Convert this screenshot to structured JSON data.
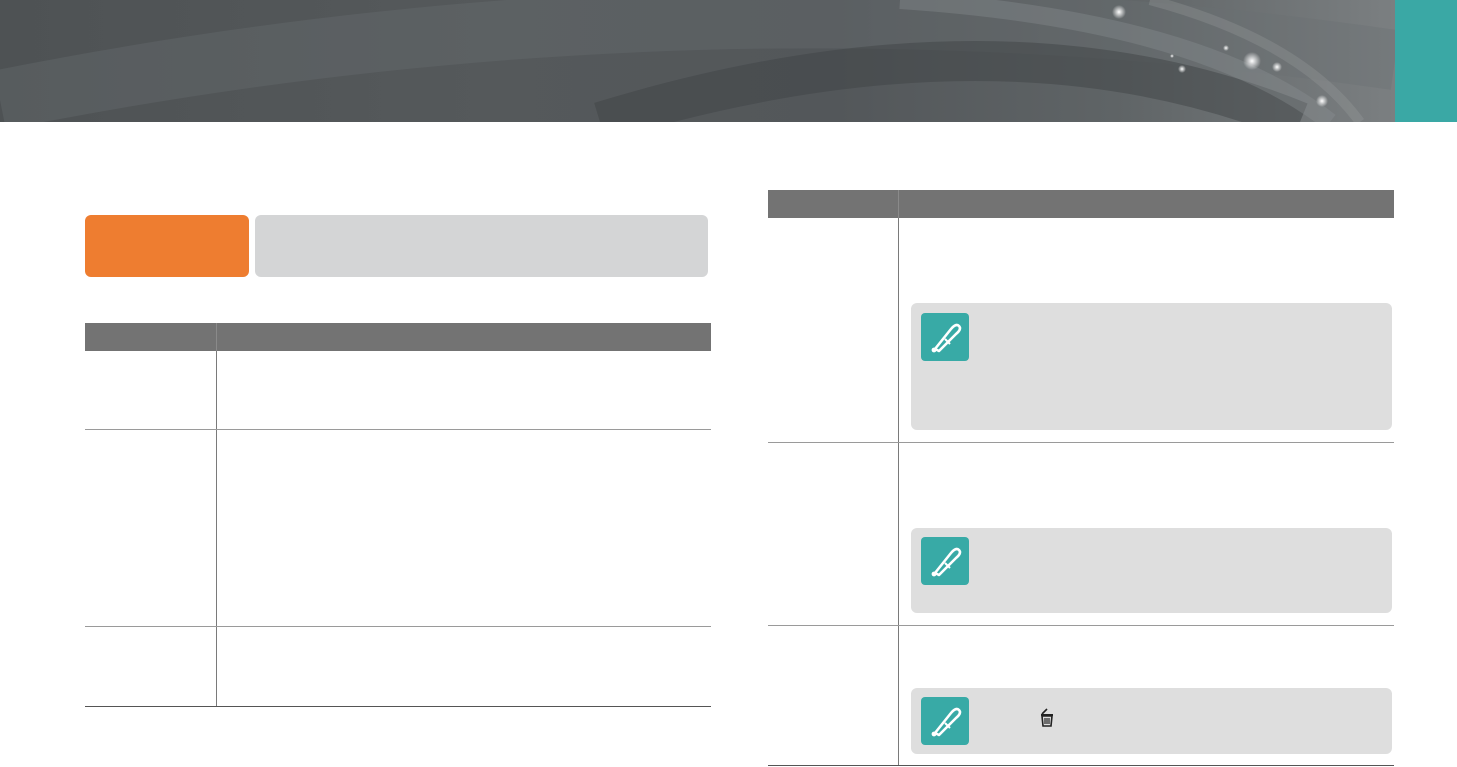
{
  "banner": {
    "colors": {
      "base": "#53575a",
      "tab": "#3aa8a5"
    }
  },
  "section_badge": {
    "label": "",
    "description": "",
    "colors": {
      "badge": "#ee7d30",
      "description_bg": "#d4d5d6"
    }
  },
  "left_table": {
    "headers": [
      "",
      ""
    ],
    "rows": [
      {
        "name": "",
        "description": ""
      },
      {
        "name": "",
        "description": ""
      },
      {
        "name": "",
        "description": ""
      }
    ]
  },
  "right_table": {
    "headers": [
      "",
      ""
    ],
    "rows": [
      {
        "name": "",
        "description": "",
        "note": ""
      },
      {
        "name": "",
        "description": "",
        "note": ""
      },
      {
        "name": "",
        "description": "",
        "note": ""
      }
    ]
  },
  "icons": {
    "note": "note-pen-icon",
    "delete": "trash-icon"
  },
  "colors": {
    "table_header": "#737373",
    "note_bg": "#dedede",
    "note_icon": "#38aaa6"
  }
}
